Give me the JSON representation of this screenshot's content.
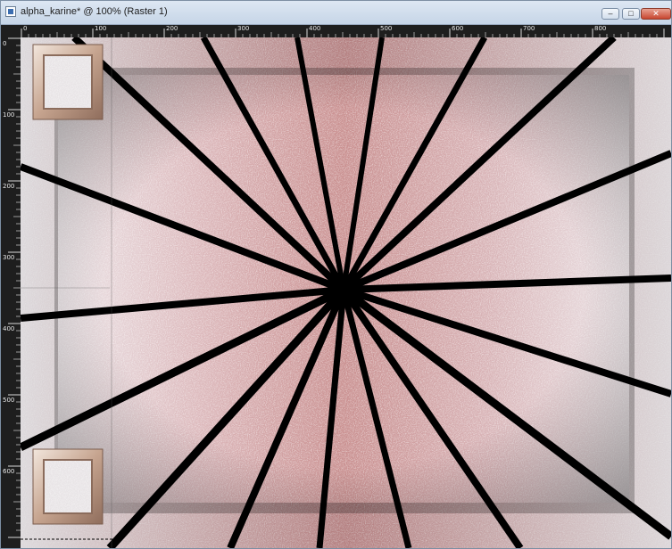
{
  "window": {
    "title": "alpha_karine* @ 100% (Raster 1)",
    "controls": {
      "minimize": "–",
      "maximize": "□",
      "close": "✕"
    }
  },
  "ruler": {
    "top_labels": [
      "0",
      "100",
      "200",
      "300",
      "400",
      "500",
      "600",
      "700",
      "800"
    ],
    "left_labels": [
      "0",
      "100",
      "200",
      "300",
      "400",
      "500",
      "600"
    ]
  },
  "canvas": {
    "description_colors": {
      "rose": "#c98f8f",
      "light": "#ebe3e6",
      "stripe": "#000000"
    }
  }
}
